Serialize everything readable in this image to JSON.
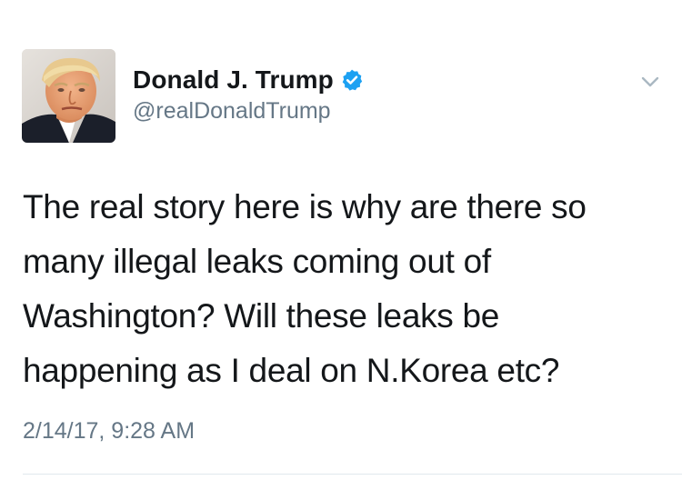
{
  "tweet": {
    "display_name": "Donald J. Trump",
    "handle": "@realDonaldTrump",
    "verified_icon": "verified-badge-icon",
    "menu_icon": "chevron-down-icon",
    "text_lines": [
      "The real story here is why are there so",
      "many illegal leaks coming out of",
      "Washington? Will these leaks be",
      "happening as I deal on N.Korea etc?"
    ],
    "timestamp": "2/14/17, 9:28 AM"
  },
  "colors": {
    "text_primary": "#14171a",
    "text_secondary": "#657786",
    "verified_blue": "#1da1f2",
    "divider": "#e1e8ed"
  }
}
